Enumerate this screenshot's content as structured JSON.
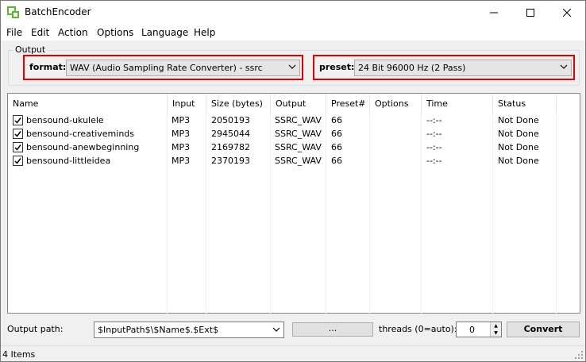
{
  "window": {
    "title": "BatchEncoder"
  },
  "menu": [
    "File",
    "Edit",
    "Action",
    "Options",
    "Language",
    "Help"
  ],
  "output_group": {
    "label": "Output",
    "format_label": "format:",
    "format_value": "WAV (Audio Sampling Rate Converter) - ssrc",
    "preset_label": "preset:",
    "preset_value": "24 Bit 96000 Hz (2 Pass)"
  },
  "list": {
    "columns": [
      "Name",
      "Input",
      "Size (bytes)",
      "Output",
      "Preset#",
      "Options",
      "Time",
      "Status"
    ],
    "rows": [
      {
        "checked": true,
        "cells": [
          "bensound-ukulele",
          "MP3",
          "2050193",
          "SSRC_WAV",
          "66",
          "",
          "--:--",
          "Not Done"
        ]
      },
      {
        "checked": true,
        "cells": [
          "bensound-creativeminds",
          "MP3",
          "2945044",
          "SSRC_WAV",
          "66",
          "",
          "--:--",
          "Not Done"
        ]
      },
      {
        "checked": true,
        "cells": [
          "bensound-anewbeginning",
          "MP3",
          "2169782",
          "SSRC_WAV",
          "66",
          "",
          "--:--",
          "Not Done"
        ]
      },
      {
        "checked": true,
        "cells": [
          "bensound-littleidea",
          "MP3",
          "2370193",
          "SSRC_WAV",
          "66",
          "",
          "--:--",
          "Not Done"
        ]
      }
    ]
  },
  "bottom": {
    "output_path_label": "Output path:",
    "output_path_value": "$InputPath$\\$Name$.$Ext$",
    "browse_label": "...",
    "threads_label": "threads (0=auto):",
    "threads_value": "0",
    "convert_label": "Convert"
  },
  "status": {
    "text": "4 Items"
  },
  "colors": {
    "highlight": "#e00000"
  }
}
